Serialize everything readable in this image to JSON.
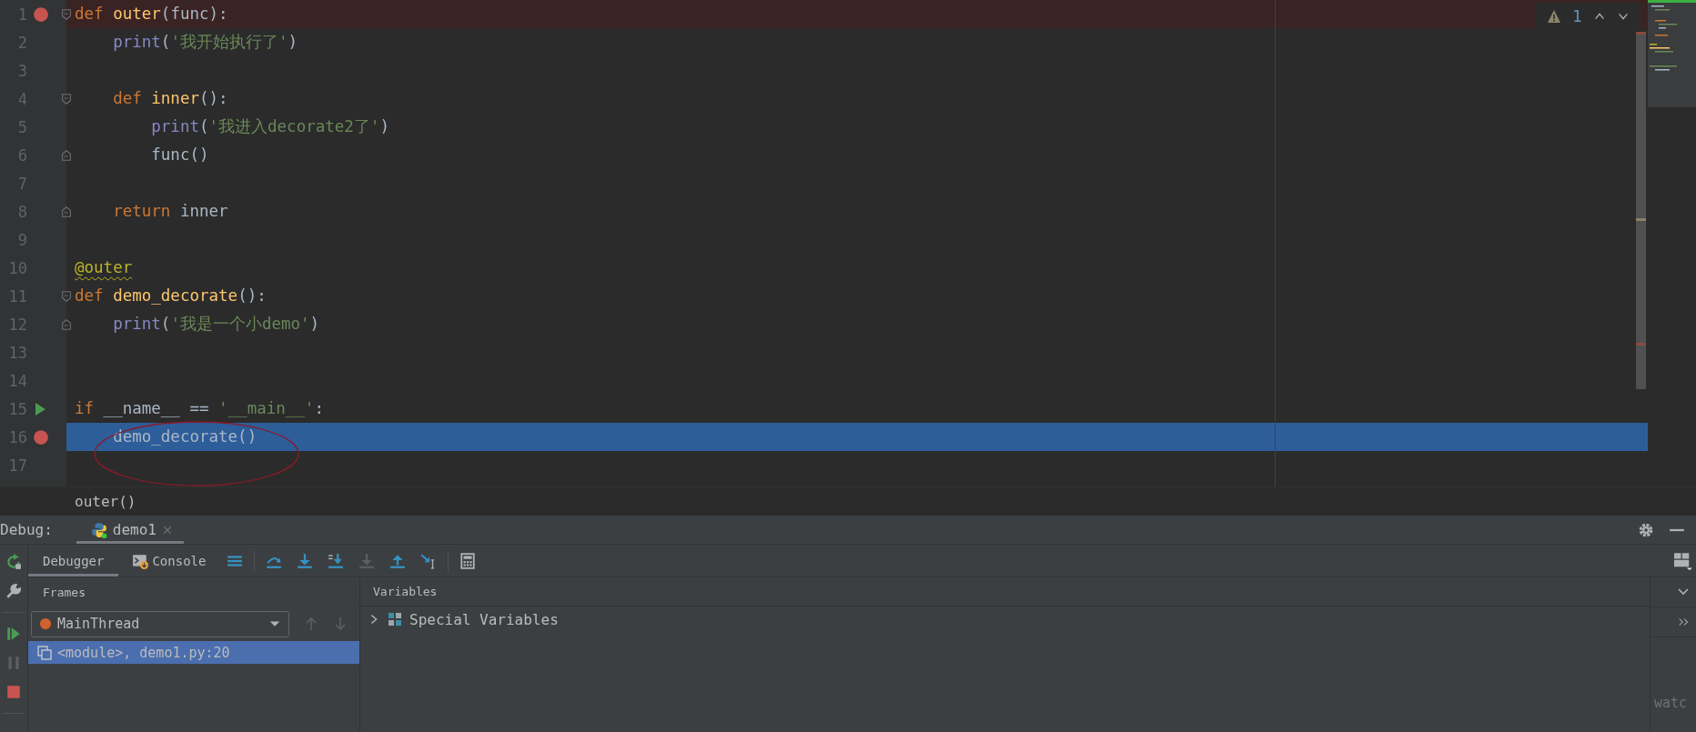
{
  "editor": {
    "lines": [
      {
        "number": "1",
        "breakpoint": true,
        "execution": false,
        "fold": {
          "kind": "start"
        },
        "tokens": [
          {
            "text": "def ",
            "kind": "keyword"
          },
          {
            "text": "outer",
            "kind": "function"
          },
          {
            "text": "(func):",
            "kind": "plain"
          }
        ]
      },
      {
        "number": "2",
        "breakpoint": false,
        "execution": false,
        "tokens": [
          {
            "text": "    print",
            "kind": "builtin"
          },
          {
            "text": "(",
            "kind": "plain"
          },
          {
            "text": "'我开始执行了'",
            "kind": "string"
          },
          {
            "text": ")",
            "kind": "plain"
          }
        ]
      },
      {
        "number": "3",
        "breakpoint": false,
        "execution": false
      },
      {
        "number": "4",
        "breakpoint": false,
        "execution": false,
        "fold": {
          "kind": "start"
        },
        "tokens": [
          {
            "text": "    def ",
            "kind": "keyword"
          },
          {
            "text": "inner",
            "kind": "function"
          },
          {
            "text": "():",
            "kind": "plain"
          }
        ]
      },
      {
        "number": "5",
        "breakpoint": false,
        "execution": false,
        "tokens": [
          {
            "text": "        print",
            "kind": "builtin"
          },
          {
            "text": "(",
            "kind": "plain"
          },
          {
            "text": "'我进入decorate2了'",
            "kind": "string"
          },
          {
            "text": ")",
            "kind": "plain"
          }
        ]
      },
      {
        "number": "6",
        "breakpoint": false,
        "execution": false,
        "fold": {
          "kind": "end"
        },
        "tokens": [
          {
            "text": "        func()",
            "kind": "plain"
          }
        ]
      },
      {
        "number": "7",
        "breakpoint": false,
        "execution": false
      },
      {
        "number": "8",
        "breakpoint": false,
        "execution": false,
        "fold": {
          "kind": "end"
        },
        "tokens": [
          {
            "text": "    return",
            "kind": "keyword"
          },
          {
            "text": " inner",
            "kind": "plain"
          }
        ]
      },
      {
        "number": "9",
        "breakpoint": false,
        "execution": false
      },
      {
        "number": "10",
        "breakpoint": false,
        "execution": false,
        "tokens": [
          {
            "text": "@outer",
            "kind": "decorator",
            "warning": true
          }
        ]
      },
      {
        "number": "11",
        "breakpoint": false,
        "execution": false,
        "fold": {
          "kind": "start"
        },
        "tokens": [
          {
            "text": "def ",
            "kind": "keyword"
          },
          {
            "text": "demo_decorate",
            "kind": "function"
          },
          {
            "text": "():",
            "kind": "plain"
          }
        ]
      },
      {
        "number": "12",
        "breakpoint": false,
        "execution": false,
        "fold": {
          "kind": "end"
        },
        "tokens": [
          {
            "text": "    print",
            "kind": "builtin"
          },
          {
            "text": "(",
            "kind": "plain"
          },
          {
            "text": "'我是一个小demo'",
            "kind": "string"
          },
          {
            "text": ")",
            "kind": "plain"
          }
        ]
      },
      {
        "number": "13",
        "breakpoint": false,
        "execution": false
      },
      {
        "number": "14",
        "breakpoint": false,
        "execution": false
      },
      {
        "number": "15",
        "breakpoint": false,
        "execution": false,
        "run_marker": true,
        "tokens": [
          {
            "text": "if",
            "kind": "keyword"
          },
          {
            "text": " __name__ == ",
            "kind": "plain"
          },
          {
            "text": "'__main__'",
            "kind": "string"
          },
          {
            "text": ":",
            "kind": "plain"
          }
        ]
      },
      {
        "number": "16",
        "breakpoint": true,
        "execution": true,
        "tokens": [
          {
            "text": "    demo_decorate()",
            "kind": "plain"
          }
        ]
      },
      {
        "number": "17",
        "breakpoint": false,
        "execution": false
      }
    ],
    "inspection": {
      "warnings": "1"
    },
    "annotations": [
      {
        "kind": "ellipse"
      }
    ],
    "breadcrumb": "outer()"
  },
  "debug": {
    "label": "Debug:",
    "tabs": [
      {
        "label": "demo1",
        "selected": true
      }
    ],
    "side_buttons": [
      {
        "kind": "rerun",
        "disabled": false
      },
      {
        "kind": "wrench",
        "disabled": false
      },
      {
        "kind": "resume",
        "disabled": false
      },
      {
        "kind": "pause",
        "disabled": true
      },
      {
        "kind": "stop",
        "disabled": false
      }
    ],
    "view_tabs": [
      {
        "label": "Debugger",
        "selected": true
      },
      {
        "label": "Console",
        "selected": false
      }
    ],
    "toolbar_buttons": [
      {
        "kind": "frames-menu",
        "disabled": false
      },
      {
        "kind": "step-over",
        "disabled": false
      },
      {
        "kind": "step-into",
        "disabled": false
      },
      {
        "kind": "step-into-my-code",
        "disabled": false
      },
      {
        "kind": "force-step-into",
        "disabled": true
      },
      {
        "kind": "step-out",
        "disabled": false
      },
      {
        "kind": "run-to-cursor",
        "disabled": false
      },
      {
        "kind": "evaluate",
        "disabled": false
      }
    ],
    "frames": {
      "title": "Frames",
      "thread": "MainThread",
      "items": [
        {
          "label": "<module>, demo1.py:20",
          "selected": true
        }
      ]
    },
    "variables": {
      "title": "Variables",
      "items": [
        {
          "label": "Special Variables",
          "expanded": false
        }
      ]
    },
    "watches": {
      "label": "watc"
    }
  }
}
